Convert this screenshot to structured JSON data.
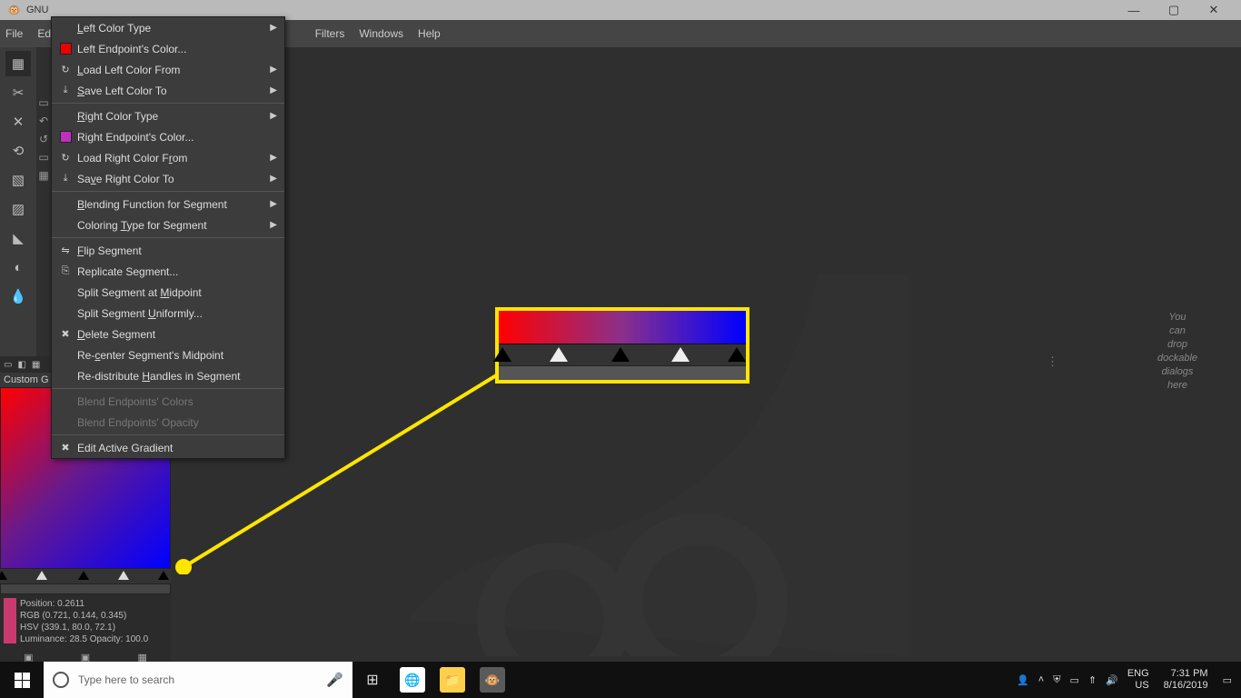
{
  "titlebar": {
    "title": "GNU"
  },
  "menubar": {
    "file": "File",
    "edit": "Edi",
    "filters": "Filters",
    "windows": "Windows",
    "help": "Help"
  },
  "context_menu": {
    "left_color_type": "Left Color Type",
    "left_endpoint_color": "Left Endpoint's Color...",
    "load_left_color": "Load Left Color From",
    "save_left_color": "Save Left Color To",
    "right_color_type": "Right Color Type",
    "right_endpoint_color": "Right Endpoint's Color...",
    "load_right_color": "Load Right Color From",
    "save_right_color": "Save Right Color To",
    "blending_func": "Blending Function for Segment",
    "coloring_type": "Coloring Type for Segment",
    "flip_segment": "Flip Segment",
    "replicate_segment": "Replicate Segment...",
    "split_midpoint": "Split Segment at Midpoint",
    "split_uniform": "Split Segment Uniformly...",
    "delete_segment": "Delete Segment",
    "recenter": "Re-center Segment's Midpoint",
    "redistribute": "Re-distribute Handles in Segment",
    "blend_colors": "Blend Endpoints' Colors",
    "blend_opacity": "Blend Endpoints' Opacity",
    "edit_active": "Edit Active Gradient"
  },
  "gradient_panel": {
    "title": "Custom G",
    "info": {
      "position": "Position: 0.2611",
      "rgb": "RGB (0.721, 0.144, 0.345)",
      "hsv": "HSV (339.1, 80.0, 72.1)",
      "luminance": "Luminance: 28.5   Opacity: 100.0"
    }
  },
  "dock_hint": {
    "l1": "You",
    "l2": "can",
    "l3": "drop",
    "l4": "dockable",
    "l5": "dialogs",
    "l6": "here"
  },
  "taskbar": {
    "search_placeholder": "Type here to search",
    "lang1": "ENG",
    "lang2": "US",
    "time": "7:31 PM",
    "date": "8/16/2019"
  }
}
